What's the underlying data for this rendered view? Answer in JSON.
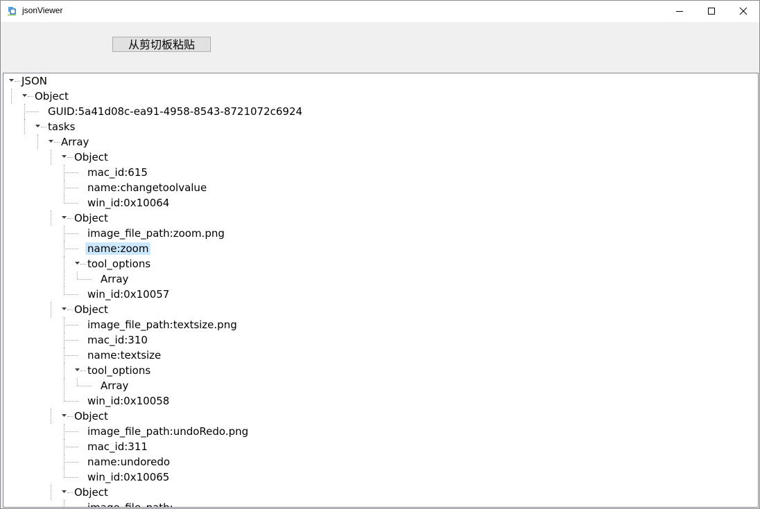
{
  "window": {
    "title": "jsonViewer"
  },
  "toolbar": {
    "paste_label": "从剪切板粘贴"
  },
  "tree": [
    {
      "label": "JSON",
      "level": 0,
      "expanded": true
    },
    {
      "label": "Object",
      "level": 1,
      "expanded": true
    },
    {
      "label": "GUID:5a41d08c-ea91-4958-8543-8721072c6924",
      "level": 2
    },
    {
      "label": "tasks",
      "level": 2,
      "expanded": true
    },
    {
      "label": "Array",
      "level": 3,
      "expanded": true
    },
    {
      "label": "Object",
      "level": 4,
      "expanded": true
    },
    {
      "label": "mac_id:615",
      "level": 5
    },
    {
      "label": "name:changetoolvalue",
      "level": 5
    },
    {
      "label": "win_id:0x10064",
      "level": 5,
      "last": true
    },
    {
      "label": "Object",
      "level": 4,
      "expanded": true
    },
    {
      "label": "image_file_path:zoom.png",
      "level": 5
    },
    {
      "label": "name:zoom",
      "level": 5,
      "selected": true
    },
    {
      "label": "tool_options",
      "level": 5,
      "expanded": true
    },
    {
      "label": "Array",
      "level": 6,
      "last": true
    },
    {
      "label": "win_id:0x10057",
      "level": 5,
      "last": true
    },
    {
      "label": "Object",
      "level": 4,
      "expanded": true
    },
    {
      "label": "image_file_path:textsize.png",
      "level": 5
    },
    {
      "label": "mac_id:310",
      "level": 5
    },
    {
      "label": "name:textsize",
      "level": 5
    },
    {
      "label": "tool_options",
      "level": 5,
      "expanded": true
    },
    {
      "label": "Array",
      "level": 6,
      "last": true
    },
    {
      "label": "win_id:0x10058",
      "level": 5,
      "last": true
    },
    {
      "label": "Object",
      "level": 4,
      "expanded": true
    },
    {
      "label": "image_file_path:undoRedo.png",
      "level": 5
    },
    {
      "label": "mac_id:311",
      "level": 5
    },
    {
      "label": "name:undoredo",
      "level": 5
    },
    {
      "label": "win_id:0x10065",
      "level": 5,
      "last": true
    },
    {
      "label": "Object",
      "level": 4,
      "expanded": true
    },
    {
      "label": "image_file_path:",
      "level": 5
    }
  ]
}
